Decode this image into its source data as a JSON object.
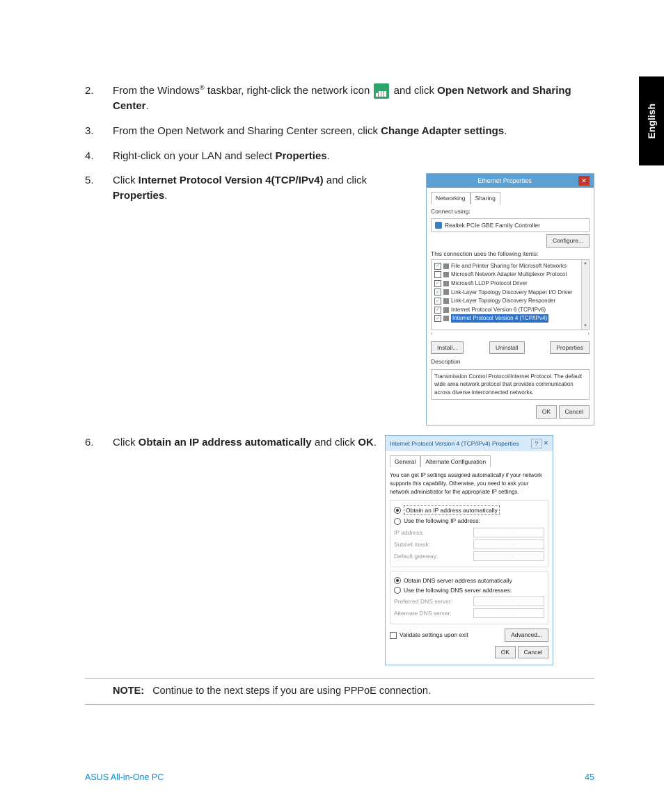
{
  "language_tab": "English",
  "steps": [
    {
      "num": "2.",
      "pre": "From the Windows",
      "reg": "®",
      "mid": " taskbar, right-click the network icon ",
      "post": " and click ",
      "bold1": "Open Network and Sharing Center",
      "tail": "."
    },
    {
      "num": "3.",
      "text_a": "From the Open Network and Sharing Center screen, click ",
      "bold": "Change Adapter settings",
      "text_b": "."
    },
    {
      "num": "4.",
      "text_a": "Right-click on your LAN and select ",
      "bold": "Properties",
      "text_b": "."
    },
    {
      "num": "5.",
      "text_a": "Click ",
      "bold1": "Internet Protocol Version 4(TCP/IPv4)",
      "text_b": " and click ",
      "bold2": "Properties",
      "text_c": "."
    },
    {
      "num": "6.",
      "text_a": "Click ",
      "bold1": "Obtain an IP address automatically",
      "text_b": " and click ",
      "bold2": "OK",
      "text_c": "."
    }
  ],
  "win1": {
    "title": "Ethernet Properties",
    "close": "✕",
    "tabs": [
      "Networking",
      "Sharing"
    ],
    "connect_label": "Connect using:",
    "adapter": "Realtek PCIe GBE Family Controller",
    "configure": "Configure...",
    "uses_label": "This connection uses the following items:",
    "items": [
      {
        "checked": true,
        "label": "File and Printer Sharing for Microsoft Networks"
      },
      {
        "checked": false,
        "label": "Microsoft Network Adapter Multiplexor Protocol"
      },
      {
        "checked": true,
        "label": "Microsoft LLDP Protocol Driver"
      },
      {
        "checked": true,
        "label": "Link-Layer Topology Discovery Mapper I/O Driver"
      },
      {
        "checked": true,
        "label": "Link-Layer Topology Discovery Responder"
      },
      {
        "checked": true,
        "label": "Internet Protocol Version 6 (TCP/IPv6)"
      },
      {
        "checked": true,
        "label": "Internet Protocol Version 4 (TCP/IPv4)",
        "selected": true
      }
    ],
    "install": "Install...",
    "uninstall": "Uninstall",
    "properties": "Properties",
    "desc_label": "Description",
    "desc_text": "Transmission Control Protocol/Internet Protocol. The default wide area network protocol that provides communication across diverse interconnected networks.",
    "ok": "OK",
    "cancel": "Cancel"
  },
  "win2": {
    "title": "Internet Protocol Version 4 (TCP/IPv4) Properties",
    "help": "?",
    "close": "✕",
    "tabs": [
      "General",
      "Alternate Configuration"
    ],
    "intro": "You can get IP settings assigned automatically if your network supports this capability. Otherwise, you need to ask your network administrator for the appropriate IP settings.",
    "r1": "Obtain an IP address automatically",
    "r2": "Use the following IP address:",
    "ip": "IP address:",
    "mask": "Subnet mask:",
    "gw": "Default gateway:",
    "r3": "Obtain DNS server address automatically",
    "r4": "Use the following DNS server addresses:",
    "dns1": "Preferred DNS server:",
    "dns2": "Alternate DNS server:",
    "validate": "Validate settings upon exit",
    "advanced": "Advanced...",
    "ok": "OK",
    "cancel": "Cancel"
  },
  "note": {
    "label": "NOTE:",
    "text": "Continue to the next steps if you are using PPPoE connection."
  },
  "footer": {
    "left": "ASUS All-in-One PC",
    "right": "45"
  }
}
